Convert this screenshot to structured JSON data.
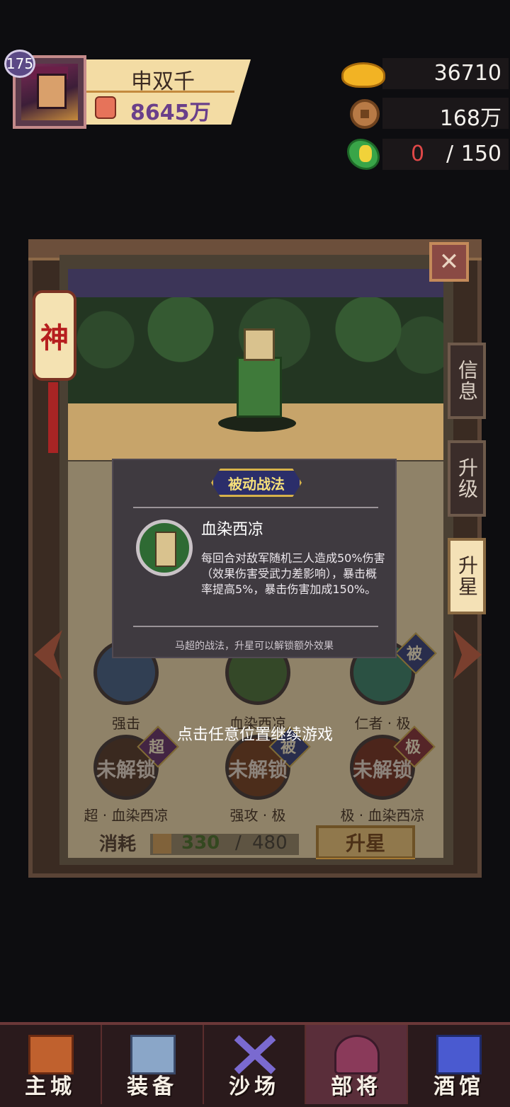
{
  "player": {
    "level": "175",
    "name": "申双千",
    "power": "8645万"
  },
  "resources": {
    "gold": "36710",
    "coins": "168万",
    "stamina_current": "0",
    "stamina_sep": "/",
    "stamina_max": "150"
  },
  "hero_panel": {
    "rank_badge": "神",
    "side_tabs": [
      "信息",
      "升级",
      "升星"
    ],
    "close_glyph": "✕"
  },
  "skills": [
    {
      "label": "强击",
      "locked": false
    },
    {
      "label": "血染西凉",
      "locked": false
    },
    {
      "label": "仁者 · 极",
      "locked": false,
      "tag": "被"
    },
    {
      "label": "超 · 血染西凉",
      "locked": true,
      "locked_text": "未解锁",
      "tag": "超"
    },
    {
      "label": "强攻 · 极",
      "locked": true,
      "locked_text": "未解锁",
      "tag": "被"
    },
    {
      "label": "极 · 血染西凉",
      "locked": true,
      "locked_text": "未解锁",
      "tag": "极"
    }
  ],
  "upgrade": {
    "cost_label": "消耗",
    "cost_current": "330",
    "cost_sep": "/",
    "cost_max": "480",
    "star_button": "升星"
  },
  "popup": {
    "title": "被动战法",
    "skill_name": "血染西凉",
    "description": "每回合对敌军随机三人造成50%伤害（效果伤害受武力差影响），暴击概率提高5%，暴击伤害加成150%。",
    "note": "马超的战法，升星可以解锁额外效果"
  },
  "hint": "点击任意位置继续游戏",
  "nav": [
    {
      "label": "主城",
      "icon": "castle-icon",
      "color": "#c0612e"
    },
    {
      "label": "装备",
      "icon": "chest-icon",
      "color": "#8aa6c8"
    },
    {
      "label": "沙场",
      "icon": "crossed-swords-icon",
      "color": "#7a6ad0"
    },
    {
      "label": "部将",
      "icon": "helmet-icon",
      "color": "#8a3a5a"
    },
    {
      "label": "酒馆",
      "icon": "pagoda-icon",
      "color": "#4a5ad0"
    }
  ],
  "colors": {
    "accent_gold": "#f2b324",
    "stamina_zero": "#e04848",
    "power_text": "#6a3f8a"
  }
}
